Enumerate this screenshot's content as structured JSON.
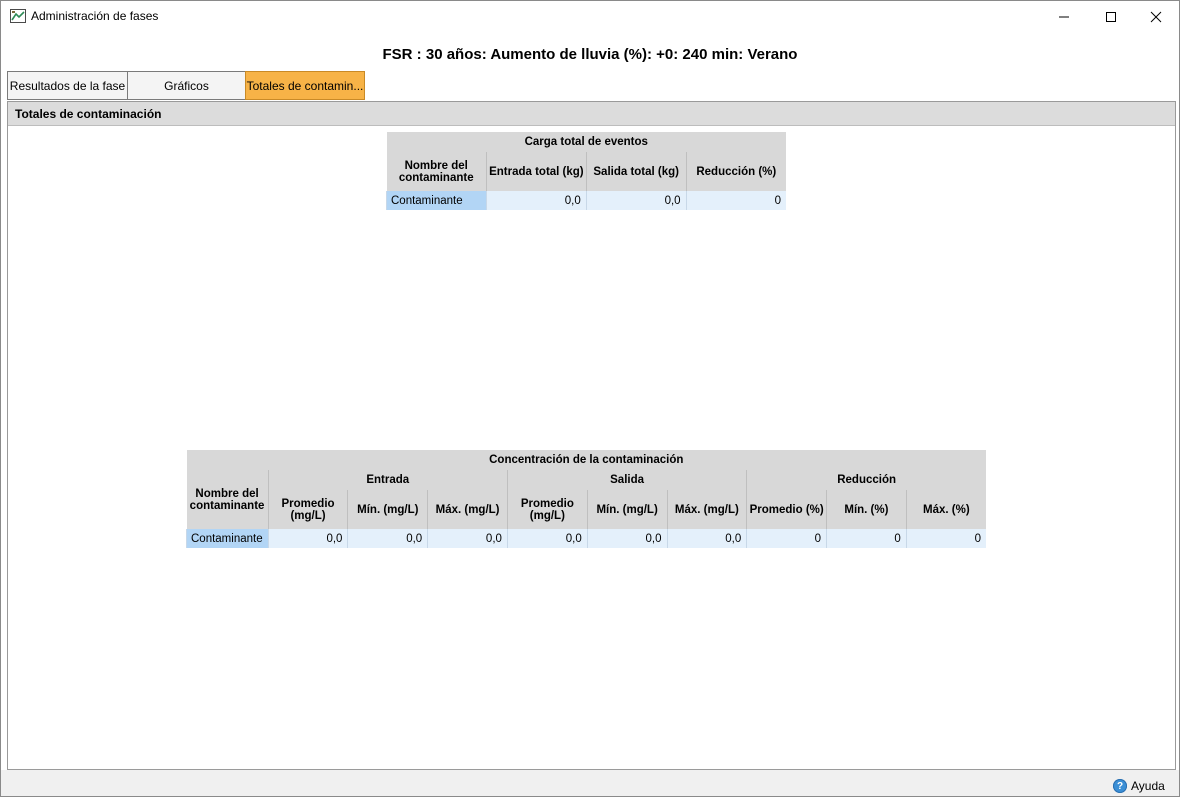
{
  "window": {
    "title": "Administración de fases",
    "min_glyph": "—",
    "max_glyph": "☐",
    "close_glyph": "✕"
  },
  "header": {
    "title": "FSR : 30 años: Aumento de lluvia (%): +0: 240 min: Verano"
  },
  "tabs": [
    {
      "label": "Resultados de la fase",
      "active": false
    },
    {
      "label": "Gráficos",
      "active": false
    },
    {
      "label": "Totales de contamin...",
      "active": true
    }
  ],
  "section": {
    "title": "Totales de contaminación"
  },
  "table1": {
    "caption": "Carga total de eventos",
    "headers": [
      "Nombre del contaminante",
      "Entrada total (kg)",
      "Salida total (kg)",
      "Reducción (%)"
    ],
    "rows": [
      [
        "Contaminante",
        "0,0",
        "0,0",
        "0"
      ]
    ]
  },
  "table2": {
    "caption": "Concentración de la contaminación",
    "name_header": "Nombre del contaminante",
    "groups": [
      "Entrada",
      "Salida",
      "Reducción"
    ],
    "subheaders": [
      "Promedio (mg/L)",
      "Mín. (mg/L)",
      "Máx. (mg/L)",
      "Promedio (mg/L)",
      "Mín. (mg/L)",
      "Máx. (mg/L)",
      "Promedio (%)",
      "Mín. (%)",
      "Máx. (%)"
    ],
    "rows": [
      [
        "Contaminante",
        "0,0",
        "0,0",
        "0,0",
        "0,0",
        "0,0",
        "0,0",
        "0",
        "0",
        "0"
      ]
    ]
  },
  "footer": {
    "help_label": "Ayuda",
    "help_glyph": "?"
  },
  "colors": {
    "active_tab": "#f7b347",
    "name_cell": "#b2d5f5",
    "value_cell": "#e4f0fb",
    "header_bg": "#d8d8d8"
  }
}
